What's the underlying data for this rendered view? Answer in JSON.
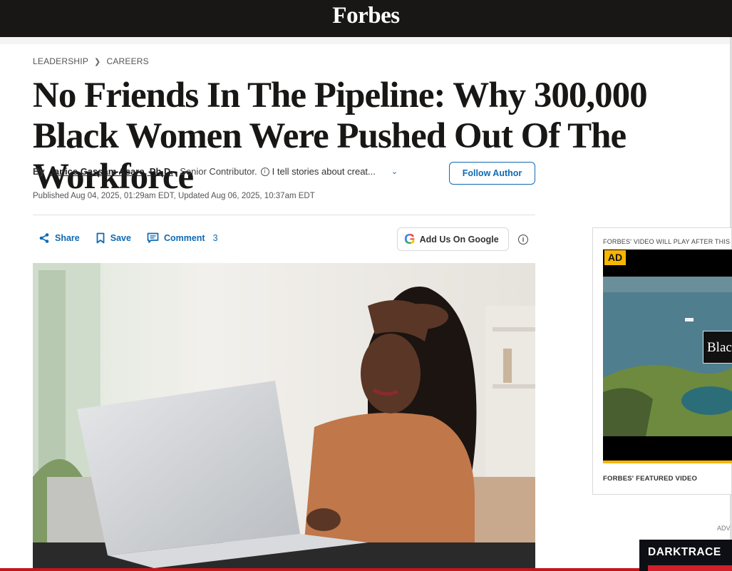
{
  "site": {
    "logo_text": "Forbes"
  },
  "breadcrumb": {
    "items": [
      "LEADERSHIP",
      "CAREERS"
    ]
  },
  "article": {
    "headline": "No Friends In The Pipeline: Why 300,000 Black Women Were Pushed Out Of The Workforce",
    "byline": {
      "prefix": "By",
      "author": "Janice Gassam Asare, Ph.D.",
      "role": ", Senior Contributor.",
      "bio": "I tell stories about creat..."
    },
    "follow_label": "Follow Author",
    "published": "Published Aug 04, 2025, 01:29am EDT, Updated Aug 06, 2025, 10:37am EDT"
  },
  "actions": {
    "share_label": "Share",
    "save_label": "Save",
    "comment_label": "Comment",
    "comment_count": "3",
    "google_label": "Add Us On Google"
  },
  "sidebar": {
    "video_note": "FORBES' VIDEO WILL PLAY AFTER THIS",
    "ad_badge": "AD",
    "video_title_fragment": "Blac",
    "video_caption": "FORBES' FEATURED VIDEO",
    "adv_label": "ADV",
    "ad_brand": "DARKTRACE"
  },
  "colors": {
    "topbar": "#181716",
    "link_blue": "#0f6ab4",
    "ad_yellow": "#f7b500",
    "accent_red": "#c4151c"
  }
}
